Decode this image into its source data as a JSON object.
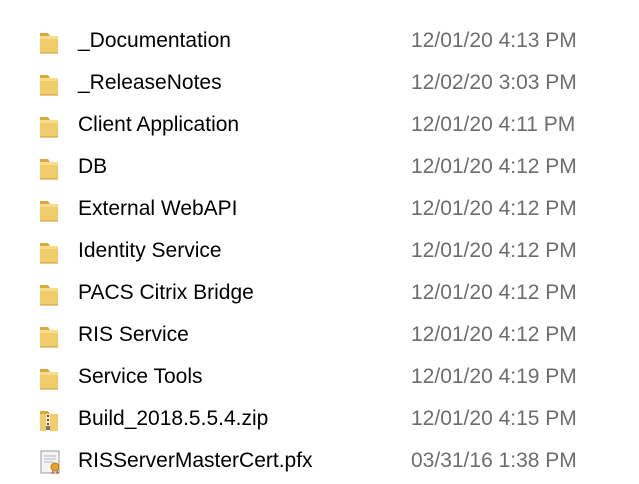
{
  "colors": {
    "name_text": "#000000",
    "date_text": "#6d6d6d",
    "folder": "#e8c15a",
    "background": "#ffffff"
  },
  "files": [
    {
      "name": "_Documentation",
      "modified": "12/01/20 4:13 PM",
      "icon": "folder-icon"
    },
    {
      "name": "_ReleaseNotes",
      "modified": "12/02/20 3:03 PM",
      "icon": "folder-icon"
    },
    {
      "name": "Client Application",
      "modified": "12/01/20 4:11 PM",
      "icon": "folder-icon"
    },
    {
      "name": "DB",
      "modified": "12/01/20 4:12 PM",
      "icon": "folder-icon"
    },
    {
      "name": "External WebAPI",
      "modified": "12/01/20 4:12 PM",
      "icon": "folder-icon"
    },
    {
      "name": "Identity Service",
      "modified": "12/01/20 4:12 PM",
      "icon": "folder-icon"
    },
    {
      "name": "PACS Citrix Bridge",
      "modified": "12/01/20 4:12 PM",
      "icon": "folder-icon"
    },
    {
      "name": "RIS Service",
      "modified": "12/01/20 4:12 PM",
      "icon": "folder-icon"
    },
    {
      "name": "Service Tools",
      "modified": "12/01/20 4:19 PM",
      "icon": "folder-icon"
    },
    {
      "name": "Build_2018.5.5.4.zip",
      "modified": "12/01/20 4:15 PM",
      "icon": "zip-archive-icon"
    },
    {
      "name": "RISServerMasterCert.pfx",
      "modified": "03/31/16 1:38 PM",
      "icon": "certificate-file-icon"
    }
  ]
}
